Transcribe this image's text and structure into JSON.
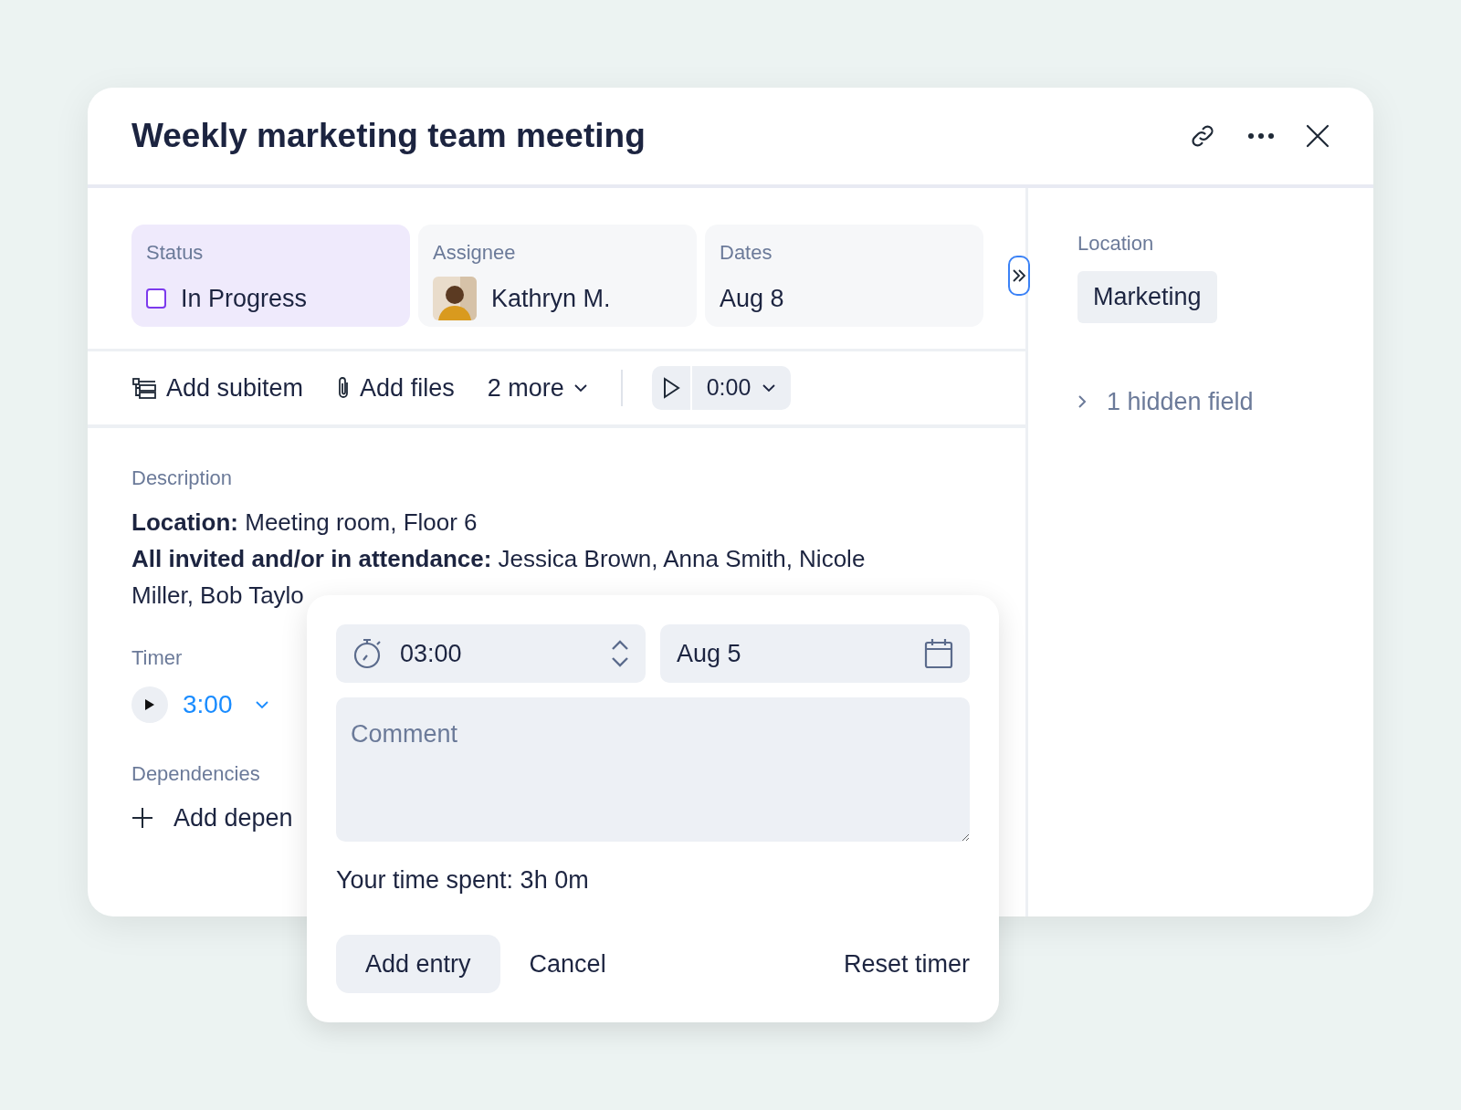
{
  "dialog": {
    "title": "Weekly marketing team meeting"
  },
  "fields": [
    {
      "label": "Status",
      "value": "In Progress",
      "kind": "status",
      "selected": true
    },
    {
      "label": "Assignee",
      "value": "Kathryn M.",
      "kind": "person",
      "selected": false
    },
    {
      "label": "Dates",
      "value": "Aug 8",
      "kind": "date",
      "selected": false
    }
  ],
  "toolbar": {
    "items": [
      {
        "label": "Add subitem",
        "kind": "subitem"
      },
      {
        "label": "Add files",
        "kind": "files"
      },
      {
        "label": "2 more",
        "kind": "more"
      }
    ],
    "timer_value": "0:00"
  },
  "sidebar": {
    "location_label": "Location",
    "location_tag": "Marketing",
    "hidden_fields": "1 hidden field"
  },
  "description": {
    "label": "Description",
    "lines": [
      "**Location:** Meeting room, Floor 6",
      "**All invited and/or in attendance:** Jessica Brown, Anna Smith, Nicole Miller, Bob Taylo"
    ]
  },
  "timer": {
    "label": "Timer",
    "value": "3:00"
  },
  "dependencies": {
    "label": "Dependencies",
    "action": "Add depen"
  },
  "popup": {
    "duration": "03:00",
    "date": "Aug 5",
    "comment_placeholder": "Comment",
    "summary": "Your time spent: 3h 0m",
    "buttons": [
      {
        "label": "Add entry",
        "kind": "filled"
      },
      {
        "label": "Cancel",
        "kind": "plain"
      },
      {
        "label": "Reset timer",
        "kind": "plain"
      }
    ]
  }
}
